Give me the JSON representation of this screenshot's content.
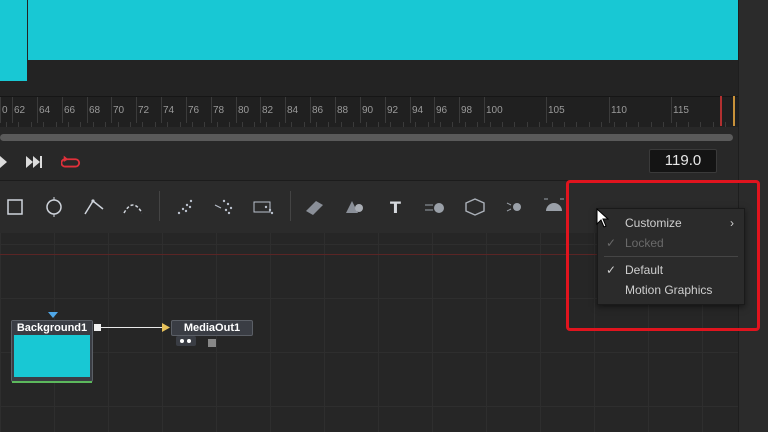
{
  "ruler": {
    "labels": [
      "0",
      "62",
      "64",
      "66",
      "68",
      "70",
      "72",
      "74",
      "76",
      "78",
      "80",
      "82",
      "84",
      "86",
      "88",
      "90",
      "92",
      "94",
      "96",
      "98",
      "100",
      "105",
      "110",
      "115"
    ]
  },
  "transport": {
    "frame_value": "119.0"
  },
  "nodes": {
    "background": {
      "label": "Background1",
      "color": "#18c8d4"
    },
    "media_out": {
      "label": "MediaOut1"
    }
  },
  "context_menu": {
    "items": [
      {
        "label": "Customize",
        "enabled": true,
        "checked": false,
        "submenu": true
      },
      {
        "label": "Locked",
        "enabled": false,
        "checked": true,
        "submenu": false
      },
      {
        "label": "Default",
        "enabled": true,
        "checked": true,
        "submenu": false
      },
      {
        "label": "Motion Graphics",
        "enabled": true,
        "checked": false,
        "submenu": false
      }
    ]
  },
  "colors": {
    "accent_cyan": "#18c8d4",
    "highlight_red": "#e0141e",
    "loop_red": "#e0303a"
  }
}
